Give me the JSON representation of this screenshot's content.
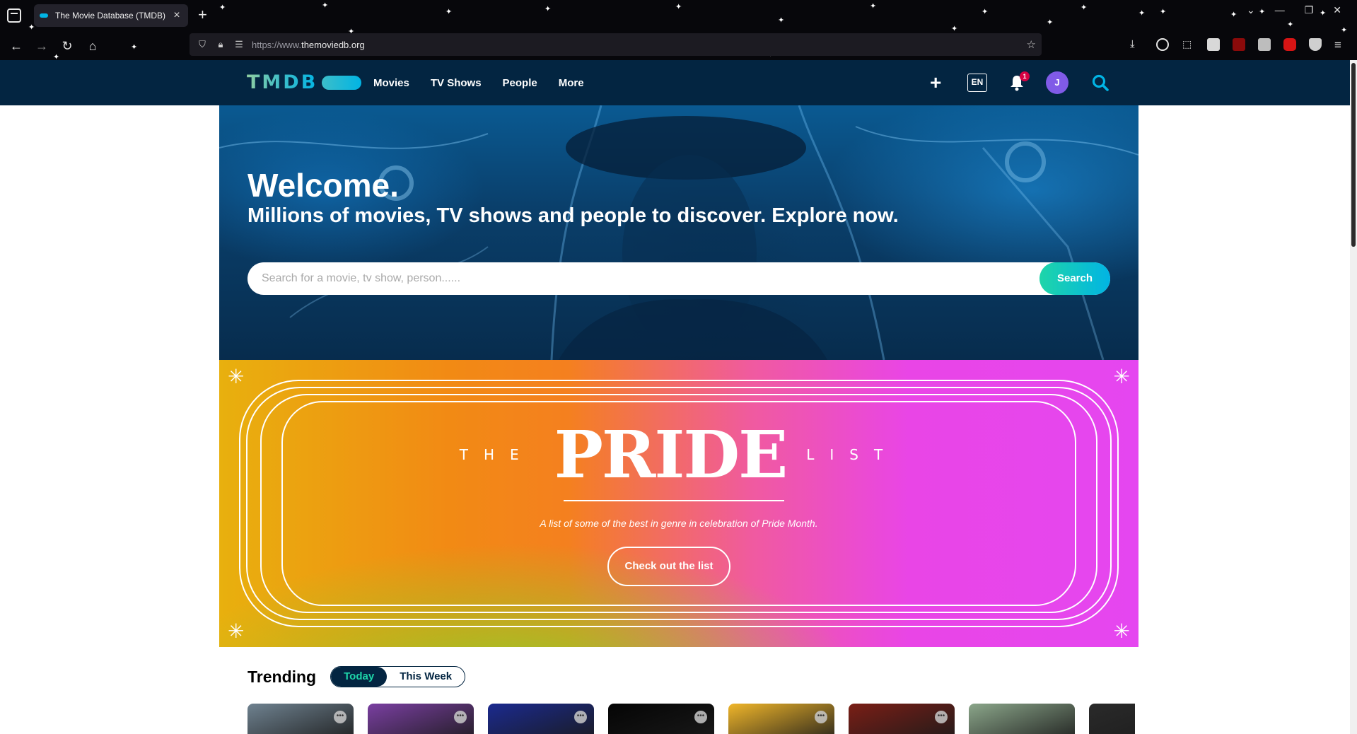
{
  "browser": {
    "tab_title": "The Movie Database (TMDB)",
    "url_prefix": "https://www.",
    "url_domain": "themoviedb.org",
    "icons": [
      "tab-list-icon",
      "close-icon",
      "plus-icon",
      "back-icon",
      "forward-icon",
      "reload-icon",
      "home-icon",
      "shield-icon",
      "lock-icon",
      "permissions-icon",
      "star-icon",
      "download-icon",
      "account-icon",
      "extensions-icon",
      "menu-icon"
    ]
  },
  "header": {
    "logo": "TMDB",
    "menu": [
      "Movies",
      "TV Shows",
      "People",
      "More"
    ],
    "lang": "EN",
    "notification_count": "1",
    "avatar_initial": "J",
    "colors": {
      "bg": "#032541",
      "accent": "#01b4e4",
      "green": "#90cea1",
      "avatar": "#805be7"
    }
  },
  "hero": {
    "title": "Welcome.",
    "subtitle": "Millions of movies, TV shows and people to discover. Explore now.",
    "search_placeholder": "Search for a movie, tv show, person......",
    "search_button": "Search"
  },
  "pride": {
    "left": "THE",
    "big": "PRIDE",
    "right": "LIST",
    "description": "A list of some of the best in genre in celebration of Pride Month.",
    "button": "Check out the list"
  },
  "trending": {
    "title": "Trending",
    "options": [
      "Today",
      "This Week"
    ],
    "active": "Today",
    "card_colors": [
      "#6f8290",
      "#7a3fa1",
      "#1b2a8f",
      "#050505",
      "#f0b62a",
      "#7a1e16",
      "#8ba68a",
      "#2a2a2a"
    ]
  }
}
